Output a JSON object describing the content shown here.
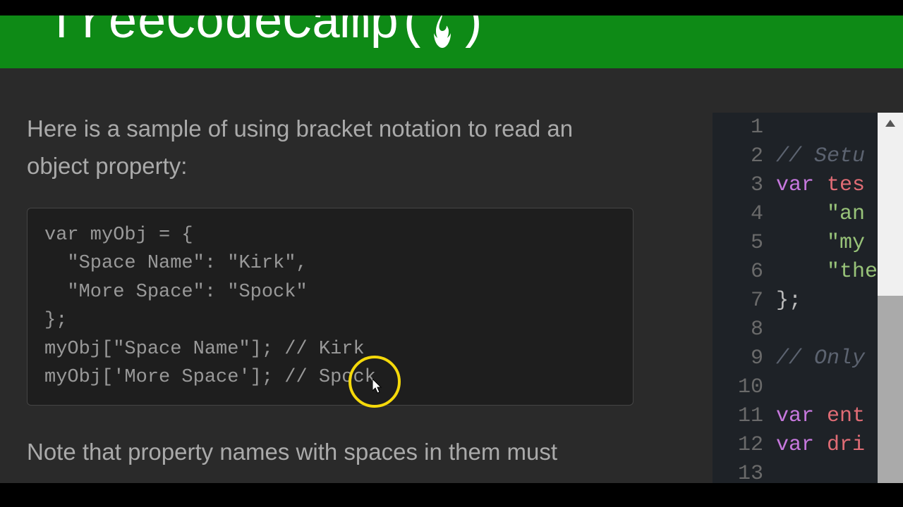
{
  "header": {
    "brand": "freeCodeCamp",
    "openParen": "(",
    "closeParen": ")"
  },
  "lesson": {
    "intro": "Here is a sample of using bracket notation to read an object property:",
    "code_sample": "var myObj = {\n  \"Space Name\": \"Kirk\",\n  \"More Space\": \"Spock\"\n};\nmyObj[\"Space Name\"]; // Kirk\nmyObj['More Space']; // Spock",
    "followup": "Note that property names with spaces in them must"
  },
  "editor": {
    "lines": [
      {
        "num": "1",
        "parts": []
      },
      {
        "num": "2",
        "parts": [
          {
            "t": "cm",
            "v": "// Setu"
          }
        ]
      },
      {
        "num": "3",
        "parts": [
          {
            "t": "kw",
            "v": "var"
          },
          {
            "t": "code-txt",
            "v": " "
          },
          {
            "t": "vr",
            "v": "tes"
          }
        ]
      },
      {
        "num": "4",
        "parts": [
          {
            "t": "code-txt",
            "v": "    "
          },
          {
            "t": "st",
            "v": "\"an e"
          }
        ]
      },
      {
        "num": "5",
        "parts": [
          {
            "t": "code-txt",
            "v": "    "
          },
          {
            "t": "st",
            "v": "\"my s"
          }
        ]
      },
      {
        "num": "6",
        "parts": [
          {
            "t": "code-txt",
            "v": "    "
          },
          {
            "t": "st",
            "v": "\"the "
          }
        ]
      },
      {
        "num": "7",
        "parts": [
          {
            "t": "code-txt",
            "v": "};"
          }
        ]
      },
      {
        "num": "8",
        "parts": []
      },
      {
        "num": "9",
        "parts": [
          {
            "t": "cm",
            "v": "// Only"
          }
        ]
      },
      {
        "num": "10",
        "parts": []
      },
      {
        "num": "11",
        "parts": [
          {
            "t": "kw",
            "v": "var"
          },
          {
            "t": "code-txt",
            "v": " "
          },
          {
            "t": "vr",
            "v": "ent"
          }
        ]
      },
      {
        "num": "12",
        "parts": [
          {
            "t": "kw",
            "v": "var"
          },
          {
            "t": "code-txt",
            "v": " "
          },
          {
            "t": "vr",
            "v": "dri"
          }
        ]
      },
      {
        "num": "13",
        "parts": []
      }
    ]
  }
}
